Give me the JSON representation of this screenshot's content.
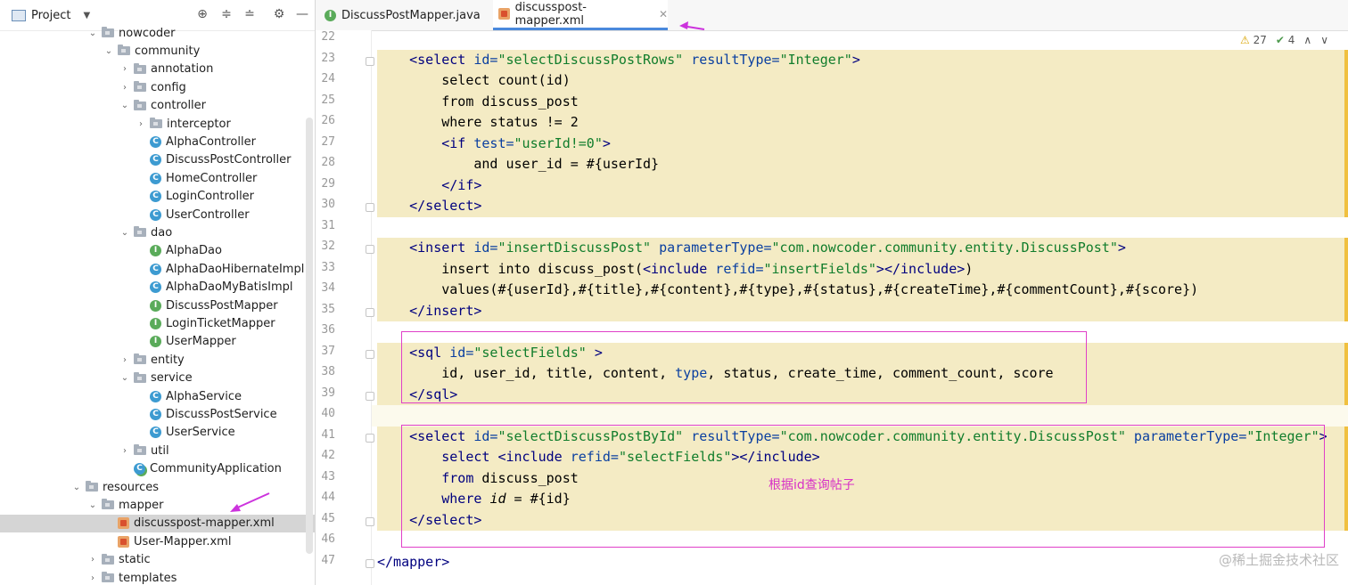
{
  "project_panel": {
    "title": "Project",
    "tree": [
      {
        "label": "nowcoder",
        "type": "folder",
        "depth": 0,
        "expanded": true,
        "selected": false
      },
      {
        "label": "community",
        "type": "folder",
        "depth": 1,
        "expanded": true,
        "selected": false
      },
      {
        "label": "annotation",
        "type": "folder",
        "depth": 2,
        "expanded": false,
        "selected": false
      },
      {
        "label": "config",
        "type": "folder",
        "depth": 2,
        "expanded": false,
        "selected": false
      },
      {
        "label": "controller",
        "type": "folder",
        "depth": 2,
        "expanded": true,
        "selected": false
      },
      {
        "label": "interceptor",
        "type": "folder",
        "depth": 3,
        "expanded": false,
        "selected": false
      },
      {
        "label": "AlphaController",
        "type": "class",
        "depth": 3,
        "selected": false
      },
      {
        "label": "DiscussPostController",
        "type": "class",
        "depth": 3,
        "selected": false
      },
      {
        "label": "HomeController",
        "type": "class",
        "depth": 3,
        "selected": false
      },
      {
        "label": "LoginController",
        "type": "class",
        "depth": 3,
        "selected": false
      },
      {
        "label": "UserController",
        "type": "class",
        "depth": 3,
        "selected": false
      },
      {
        "label": "dao",
        "type": "folder",
        "depth": 2,
        "expanded": true,
        "selected": false
      },
      {
        "label": "AlphaDao",
        "type": "interface",
        "depth": 3,
        "selected": false
      },
      {
        "label": "AlphaDaoHibernateImpl",
        "type": "class",
        "depth": 3,
        "selected": false
      },
      {
        "label": "AlphaDaoMyBatisImpl",
        "type": "class",
        "depth": 3,
        "selected": false
      },
      {
        "label": "DiscussPostMapper",
        "type": "interface",
        "depth": 3,
        "selected": false
      },
      {
        "label": "LoginTicketMapper",
        "type": "interface",
        "depth": 3,
        "selected": false
      },
      {
        "label": "UserMapper",
        "type": "interface",
        "depth": 3,
        "selected": false
      },
      {
        "label": "entity",
        "type": "folder",
        "depth": 2,
        "expanded": false,
        "selected": false
      },
      {
        "label": "service",
        "type": "folder",
        "depth": 2,
        "expanded": true,
        "selected": false
      },
      {
        "label": "AlphaService",
        "type": "class",
        "depth": 3,
        "selected": false
      },
      {
        "label": "DiscussPostService",
        "type": "class",
        "depth": 3,
        "selected": false
      },
      {
        "label": "UserService",
        "type": "class",
        "depth": 3,
        "selected": false
      },
      {
        "label": "util",
        "type": "folder",
        "depth": 2,
        "expanded": false,
        "selected": false
      },
      {
        "label": "CommunityApplication",
        "type": "app",
        "depth": 2,
        "selected": false
      },
      {
        "label": "resources",
        "type": "folder",
        "depth": -1,
        "expanded": true,
        "selected": false
      },
      {
        "label": "mapper",
        "type": "folder",
        "depth": 0,
        "expanded": true,
        "selected": false
      },
      {
        "label": "discusspost-mapper.xml",
        "type": "xml",
        "depth": 1,
        "selected": true
      },
      {
        "label": "User-Mapper.xml",
        "type": "xml",
        "depth": 1,
        "selected": false
      },
      {
        "label": "static",
        "type": "folder",
        "depth": 0,
        "expanded": false,
        "selected": false
      },
      {
        "label": "templates",
        "type": "folder",
        "depth": 0,
        "expanded": false,
        "selected": false
      }
    ]
  },
  "tabs": [
    {
      "label": "DiscussPostMapper.java",
      "icon": "interface-icon",
      "active": false
    },
    {
      "label": "discusspost-mapper.xml",
      "icon": "xml-icon",
      "active": true
    }
  ],
  "inspections": {
    "warnings": "27",
    "checks": "4"
  },
  "editor": {
    "lines": [
      {
        "n": "22",
        "html": ""
      },
      {
        "n": "23",
        "html": "    <span class=\"t\">&lt;select </span><span class=\"a\">id=</span><span class=\"v\">\"selectDiscussPostRows\"</span><span class=\"a\"> resultType=</span><span class=\"v\">\"Integer\"</span><span class=\"t\">&gt;</span>"
      },
      {
        "n": "24",
        "html": "        select count(id)"
      },
      {
        "n": "25",
        "html": "        from discuss_post"
      },
      {
        "n": "26",
        "html": "        where status != 2"
      },
      {
        "n": "27",
        "html": "        <span class=\"t\">&lt;if </span><span class=\"a\">test=</span><span class=\"v\">\"userId!=0\"</span><span class=\"t\">&gt;</span>"
      },
      {
        "n": "28",
        "html": "            and user_id = #{userId}"
      },
      {
        "n": "29",
        "html": "        <span class=\"t\">&lt;/if&gt;</span>"
      },
      {
        "n": "30",
        "html": "    <span class=\"t\">&lt;/select&gt;</span>"
      },
      {
        "n": "31",
        "html": ""
      },
      {
        "n": "32",
        "html": "    <span class=\"t\">&lt;insert </span><span class=\"a\">id=</span><span class=\"v\">\"insertDiscussPost\"</span><span class=\"a\"> parameterType=</span><span class=\"v\">\"com.nowcoder.community.entity.DiscussPost\"</span><span class=\"t\">&gt;</span>"
      },
      {
        "n": "33",
        "html": "        insert into discuss_post(<span class=\"t\">&lt;include </span><span class=\"a\">refid=</span><span class=\"v\">\"insertFields\"</span><span class=\"t\">&gt;&lt;/include&gt;</span>)"
      },
      {
        "n": "34",
        "html": "        values(#{userId},#{title},#{content},#{type},#{status},#{createTime},#{commentCount},#{score})"
      },
      {
        "n": "35",
        "html": "    <span class=\"t\">&lt;/insert&gt;</span>"
      },
      {
        "n": "36",
        "html": ""
      },
      {
        "n": "37",
        "html": "    <span class=\"t\">&lt;sql </span><span class=\"a\">id=</span><span class=\"v\">\"selectFields\"</span><span class=\"t\"> &gt;</span>"
      },
      {
        "n": "38",
        "html": "        id, user_id, title, content, <span class=\"a\">type</span>, status, create_time, comment_count, score"
      },
      {
        "n": "39",
        "html": "    <span class=\"t\">&lt;/sql&gt;</span>"
      },
      {
        "n": "40",
        "html": ""
      },
      {
        "n": "41",
        "html": "    <span class=\"t\">&lt;select </span><span class=\"a\">id=</span><span class=\"v\">\"selectDiscussPostById\"</span><span class=\"a\"> resultType=</span><span class=\"v\">\"com.nowcoder.community.entity.DiscussPost\"</span><span class=\"a\"> parameterType=</span><span class=\"v\">\"Integer\"</span><span class=\"t\">&gt;</span>"
      },
      {
        "n": "42",
        "html": "        <span class=\"t\">select </span><span class=\"t\">&lt;include </span><span class=\"a\">refid=</span><span class=\"v\">\"selectFields\"</span><span class=\"t\">&gt;&lt;/include&gt;</span>"
      },
      {
        "n": "43",
        "html": "        <span class=\"t\">from </span>discuss_post"
      },
      {
        "n": "44",
        "html": "        <span class=\"t\">where </span><span class=\"it\">id</span> = #{id}"
      },
      {
        "n": "45",
        "html": "    <span class=\"t\">&lt;/select&gt;</span>"
      },
      {
        "n": "46",
        "html": ""
      },
      {
        "n": "47",
        "html": "<span class=\"t\">&lt;/mapper&gt;</span>"
      }
    ]
  },
  "annotation_note": "根据id查询帖子",
  "watermark": "@稀土掘金技术社区",
  "colors": {
    "highlight": "#f4ebc4",
    "box": "#e040c8",
    "arrow": "#cc33dd"
  }
}
